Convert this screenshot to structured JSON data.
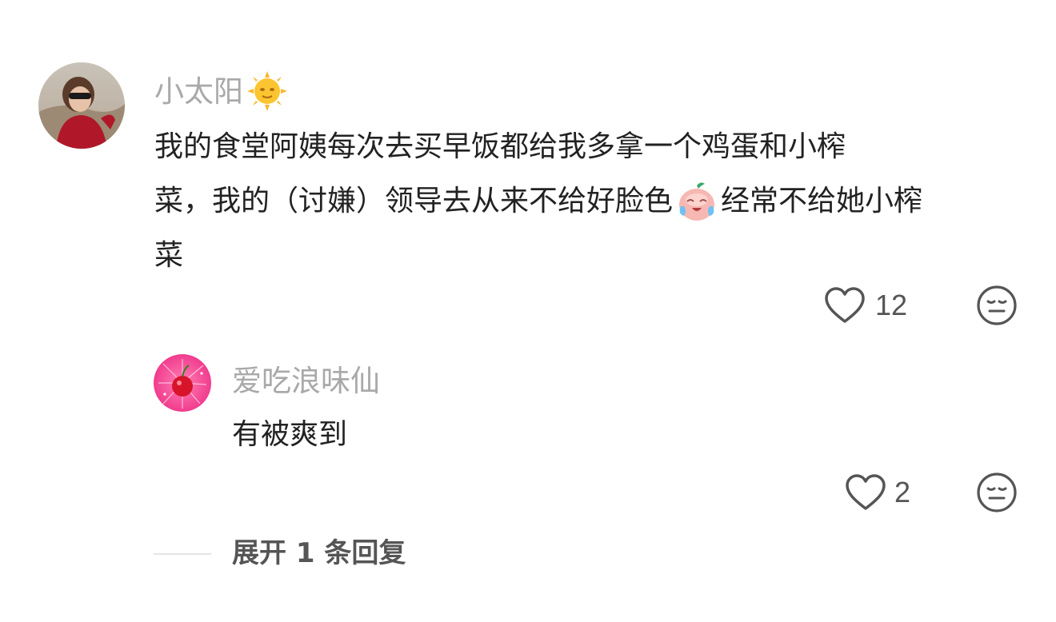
{
  "comment": {
    "username": "小太阳",
    "username_emoji": "sun-with-face",
    "text_lines": [
      "我的食堂阿姨每次去买早饭都给我多拿一个鸡蛋和小榨",
      [
        "菜，我的（讨嫌）领导去从来不给好脸色",
        "经常不给她小榨"
      ],
      "菜"
    ],
    "inline_emoji": "crying-peach-face",
    "likes": "12"
  },
  "reply": {
    "username": "爱吃浪味仙",
    "text": "有被爽到",
    "likes": "2"
  },
  "expand": {
    "label": "展开 1 条回复"
  },
  "colors": {
    "username": "#a9a9a9",
    "text": "#222222",
    "icon": "#555555",
    "reply_avatar": "#f0408a"
  }
}
